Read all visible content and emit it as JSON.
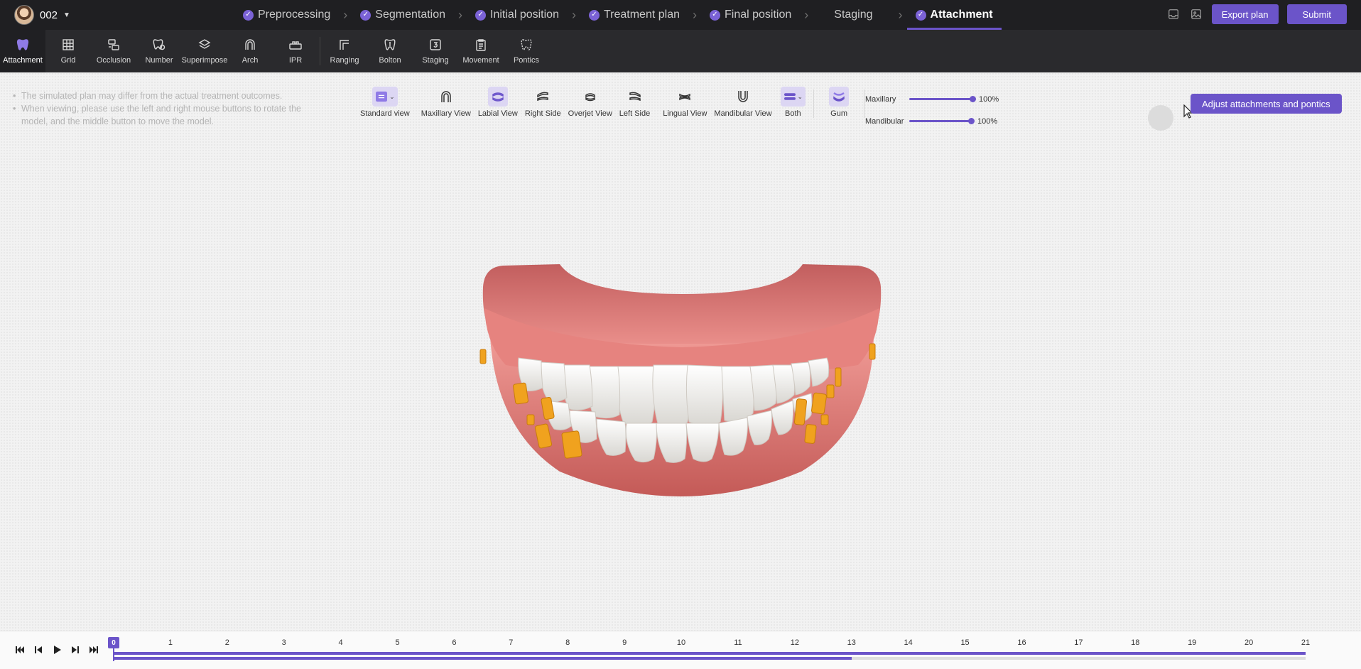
{
  "header": {
    "case_number": "002",
    "steps": [
      {
        "label": "Preprocessing",
        "done": true
      },
      {
        "label": "Segmentation",
        "done": true
      },
      {
        "label": "Initial position",
        "done": true
      },
      {
        "label": "Treatment plan",
        "done": true
      },
      {
        "label": "Final position",
        "done": true
      },
      {
        "label": "Staging",
        "done": false
      },
      {
        "label": "Attachment",
        "done": true,
        "active": true
      }
    ],
    "export_label": "Export plan",
    "submit_label": "Submit"
  },
  "toolbar": {
    "tools": [
      {
        "label": "Attachment",
        "icon": "tooth-icon",
        "active": true
      },
      {
        "label": "Grid",
        "icon": "grid-icon"
      },
      {
        "label": "Occlusion",
        "icon": "occlusion-icon"
      },
      {
        "label": "Number",
        "icon": "tooth-number-icon"
      },
      {
        "label": "Superimpose",
        "icon": "layers-icon"
      },
      {
        "label": "Arch",
        "icon": "arch-icon"
      },
      {
        "label": "IPR",
        "icon": "ipr-icon"
      },
      {
        "label": "Ranging",
        "icon": "ranging-icon"
      },
      {
        "label": "Bolton",
        "icon": "bolton-icon"
      },
      {
        "label": "Staging",
        "icon": "staging-icon"
      },
      {
        "label": "Movement",
        "icon": "movement-icon"
      },
      {
        "label": "Pontics",
        "icon": "pontics-icon"
      }
    ]
  },
  "viewport": {
    "notes": [
      "The simulated plan may differ from the actual treatment outcomes.",
      "When viewing, please use the left and right mouse buttons to rotate the model, and the middle button to move the model."
    ],
    "views": [
      {
        "label": "Standard view",
        "selected": true,
        "dropdown": true
      },
      {
        "label": "Maxillary View"
      },
      {
        "label": "Labial View",
        "selected": true
      },
      {
        "label": "Right Side"
      },
      {
        "label": "Overjet View"
      },
      {
        "label": "Left Side"
      },
      {
        "label": "Lingual View"
      },
      {
        "label": "Mandibular View"
      },
      {
        "label": "Both",
        "selected": true,
        "dropdown": true
      },
      {
        "label": "Gum",
        "selected": true
      }
    ],
    "opacity": [
      {
        "label": "Maxillary",
        "value": "100%"
      },
      {
        "label": "Mandibular",
        "value": "100%"
      }
    ],
    "adjust_label": "Adjust attachments and pontics"
  },
  "timeline": {
    "current": "0",
    "stages": [
      "0",
      "1",
      "2",
      "3",
      "4",
      "5",
      "6",
      "7",
      "8",
      "9",
      "10",
      "11",
      "12",
      "13",
      "14",
      "15",
      "16",
      "17",
      "18",
      "19",
      "20",
      "21"
    ],
    "progress_stage": 13,
    "colors": {
      "accent": "#6b54c9",
      "attachment": "#f0a21e",
      "gum": "#e07a78"
    }
  }
}
